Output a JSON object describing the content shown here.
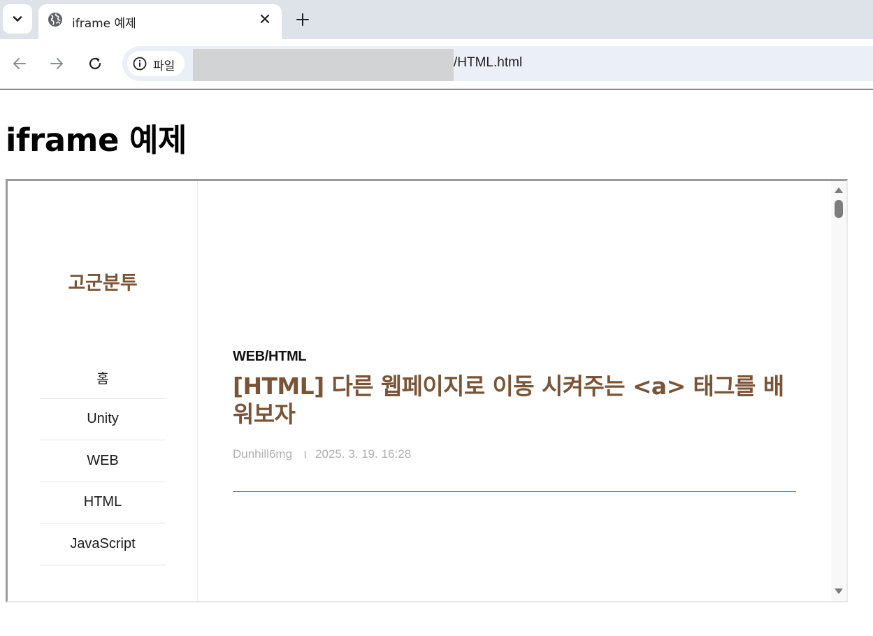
{
  "browser": {
    "tab": {
      "title": "iframe 예제",
      "icon": "globe-icon"
    },
    "address": {
      "site_info_label": "파일",
      "url_visible": "/HTML.html"
    }
  },
  "page": {
    "heading": "iframe 예제"
  },
  "iframe": {
    "blog_title": "고군분투",
    "menu": [
      {
        "label": "홈"
      },
      {
        "label": "Unity"
      },
      {
        "label": "WEB"
      },
      {
        "label": "HTML"
      },
      {
        "label": "JavaScript"
      }
    ],
    "post": {
      "category": "WEB/HTML",
      "title": "[HTML] 다른 웹페이지로 이동 시켜주는 <a> 태그를 배워보자",
      "author": "Dunhill6mg",
      "date": "2025. 3. 19. 16:28"
    }
  },
  "colors": {
    "accent_brown": "#7a5437",
    "tabstrip_bg": "#dee3ea",
    "omnibox_bg": "#ebf0f8"
  }
}
